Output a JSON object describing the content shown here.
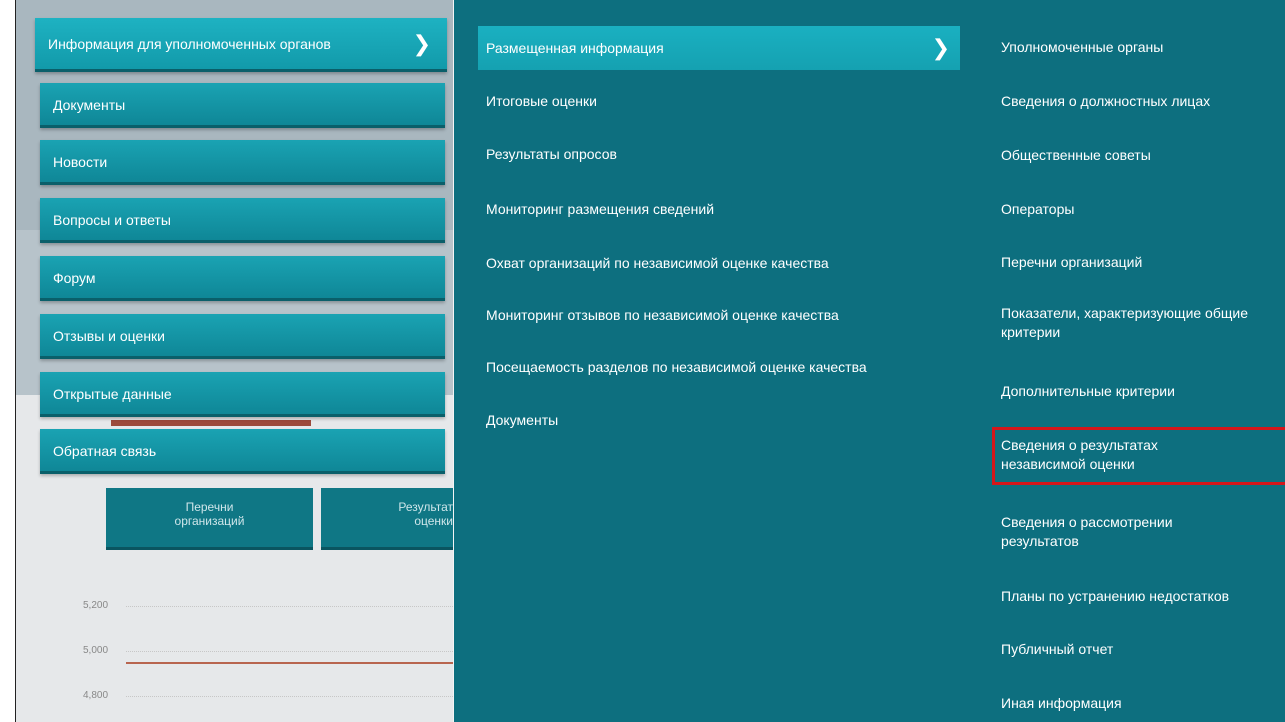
{
  "background": {
    "buttons": [
      "Перечни\nорганизаций",
      "Результат\nоценки"
    ],
    "chart_ticks": [
      "5,200",
      "5,000",
      "4,800"
    ]
  },
  "main_menu": {
    "items": [
      {
        "label": "Информация для уполномоченных органов",
        "active": true
      },
      {
        "label": "Документы"
      },
      {
        "label": "Новости"
      },
      {
        "label": "Вопросы и ответы"
      },
      {
        "label": "Форум"
      },
      {
        "label": "Отзывы и оценки"
      },
      {
        "label": "Открытые данные"
      },
      {
        "label": "Обратная связь"
      }
    ],
    "chevron": "❯"
  },
  "submenu": {
    "items": [
      {
        "label": "Размещенная информация",
        "active": true
      },
      {
        "label": "Итоговые оценки"
      },
      {
        "label": "Результаты опросов"
      },
      {
        "label": "Мониторинг размещения сведений"
      },
      {
        "label": "Охват организаций по независимой оценке качества"
      },
      {
        "label": "Мониторинг отзывов по независимой оценке качества"
      },
      {
        "label": "Посещаемость разделов по независимой оценке качества"
      },
      {
        "label": "Документы"
      }
    ],
    "chevron": "❯"
  },
  "third_menu": {
    "items": [
      {
        "label": "Уполномоченные органы"
      },
      {
        "label": "Сведения о должностных лицах"
      },
      {
        "label": "Общественные советы"
      },
      {
        "label": "Операторы"
      },
      {
        "label": "Перечни организаций"
      },
      {
        "label": "Показатели, характеризующие общие критерии"
      },
      {
        "label": "Дополнительные критерии"
      },
      {
        "label": "Сведения о результатах независимой оценки",
        "highlighted": true
      },
      {
        "label": "Сведения о рассмотрении результатов"
      },
      {
        "label": "Планы по устранению недостатков"
      },
      {
        "label": "Публичный отчет"
      },
      {
        "label": "Иная информация"
      }
    ]
  },
  "colors": {
    "menu_teal": "#0f8797",
    "panel_teal": "#0d6f7f",
    "highlight_red": "#d4161b"
  }
}
